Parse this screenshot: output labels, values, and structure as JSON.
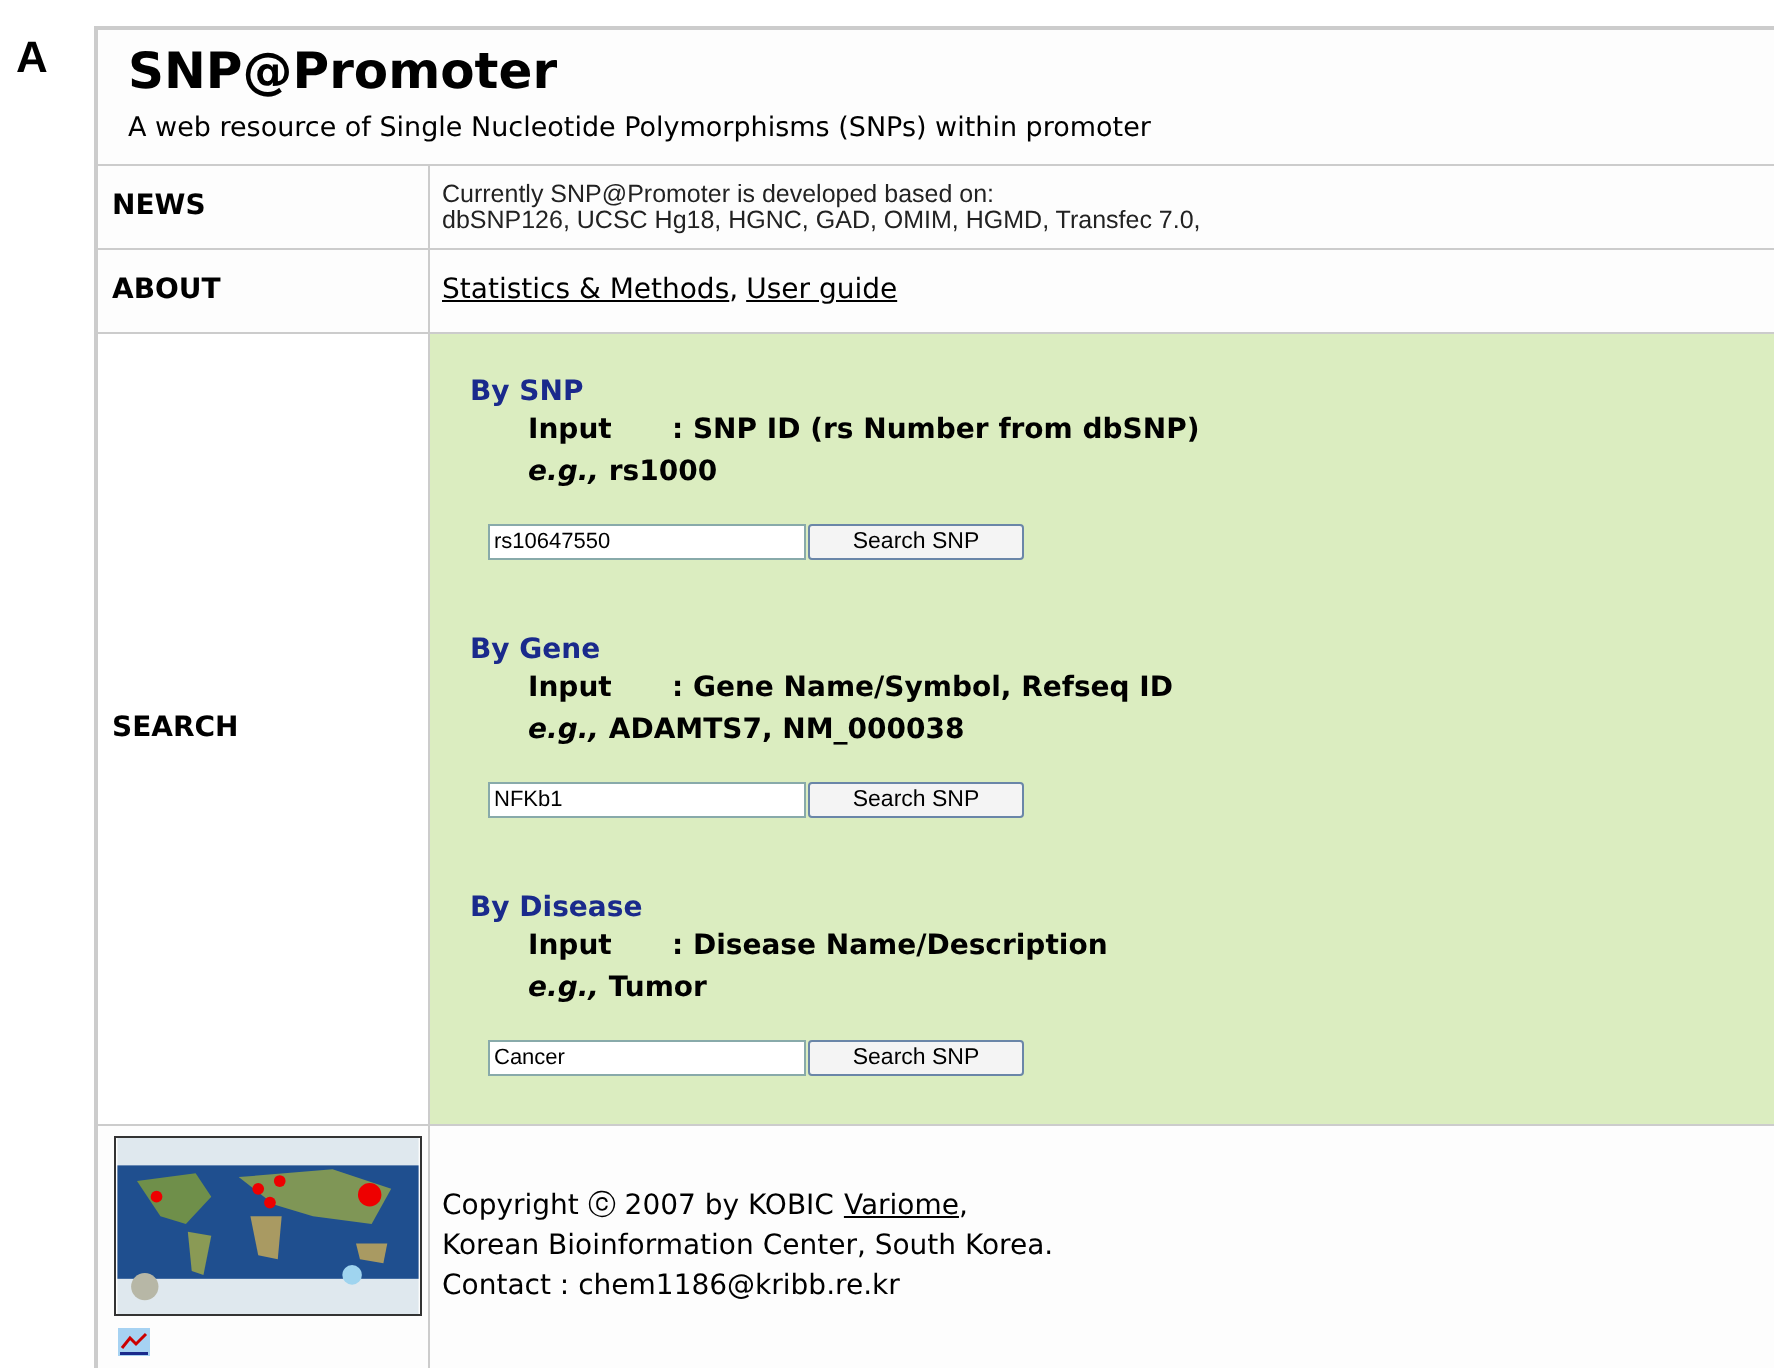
{
  "panel_label": "A",
  "header": {
    "title": "SNP@Promoter",
    "subtitle": "A web resource of Single Nucleotide Polymorphisms (SNPs) within promoter"
  },
  "news": {
    "label": "NEWS",
    "lines": [
      "Currently SNP@Promoter is developed based on:",
      "dbSNP126, UCSC Hg18, HGNC, GAD, OMIM, HGMD, Transfec 7.0,"
    ]
  },
  "about": {
    "label": "ABOUT",
    "links": [
      "Statistics & Methods",
      "User guide"
    ],
    "separator": ","
  },
  "search": {
    "label": "SEARCH",
    "sections": [
      {
        "heading": "By SNP",
        "input_label": "Input",
        "input_text": ": SNP ID (rs Number from dbSNP)",
        "example": "*e.g.,* rs1000",
        "field_value": "rs10647550",
        "button": "Search SNP"
      },
      {
        "heading": "By Gene",
        "input_label": "Input",
        "input_text": ": Gene Name/Symbol, Refseq ID",
        "example": "*e.g.,* ADAMTS7, NM_000038",
        "field_value": "NFKb1",
        "button": "Search SNP"
      },
      {
        "heading": "By Disease",
        "input_label": "Input",
        "input_text": ": Disease Name/Description",
        "example": "*e.g.,* Tumor",
        "field_value": "Cancer",
        "button": "Search SNP"
      }
    ]
  },
  "footer": {
    "copyright": "Copyright ⓒ 2007 by KOBIC",
    "link": "Variome",
    "link_suffix": ",",
    "lines": [
      "Korean Bioinformation Center, South Korea.",
      "Contact : chem1186@kribb.re.kr"
    ]
  }
}
